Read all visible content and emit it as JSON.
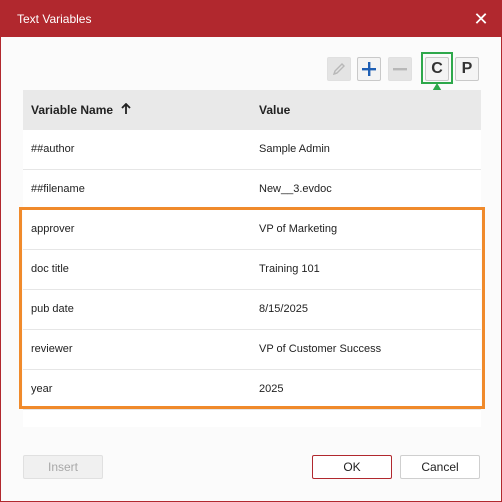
{
  "dialog": {
    "title": "Text Variables",
    "close_icon": "close-icon"
  },
  "toolbar": {
    "edit_icon": "pencil-icon",
    "add_icon": "plus-icon",
    "remove_icon": "minus-icon",
    "c_label": "C",
    "p_label": "P"
  },
  "table": {
    "headers": {
      "name": "Variable Name",
      "value": "Value"
    },
    "sort_icon": "arrow-up-icon",
    "rows": [
      {
        "name": "##author",
        "value": "Sample Admin"
      },
      {
        "name": "##filename",
        "value": "New__3.evdoc"
      },
      {
        "name": "approver",
        "value": "VP of Marketing"
      },
      {
        "name": "doc title",
        "value": "Training 101"
      },
      {
        "name": "pub date",
        "value": "8/15/2025"
      },
      {
        "name": "reviewer",
        "value": "VP of Customer Success"
      },
      {
        "name": "year",
        "value": "2025"
      }
    ]
  },
  "footer": {
    "insert_label": "Insert",
    "ok_label": "OK",
    "cancel_label": "Cancel"
  },
  "colors": {
    "title_bar": "#b1282e",
    "highlight_green": "#2ea84b",
    "highlight_orange": "#f08a2b",
    "primary_blue": "#1f5fb4"
  }
}
